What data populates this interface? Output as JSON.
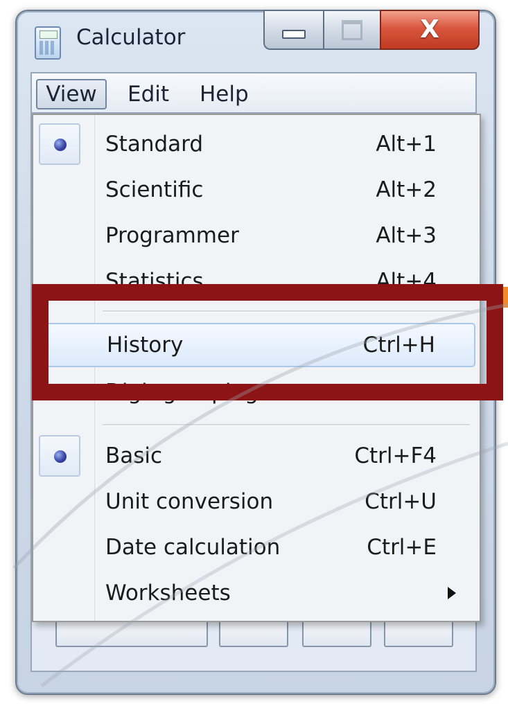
{
  "window": {
    "title": "Calculator",
    "icon": "calculator-icon",
    "controls": {
      "minimize_icon": "minimize-icon",
      "maximize_icon": "maximize-icon",
      "close_label": "X"
    }
  },
  "menubar": {
    "items": [
      {
        "label": "View",
        "active": true
      },
      {
        "label": "Edit"
      },
      {
        "label": "Help"
      }
    ]
  },
  "view_menu": {
    "items": [
      {
        "label": "Standard",
        "shortcut": "Alt+1",
        "selected": true
      },
      {
        "label": "Scientific",
        "shortcut": "Alt+2"
      },
      {
        "label": "Programmer",
        "shortcut": "Alt+3"
      },
      {
        "label": "Statistics",
        "shortcut": "Alt+4"
      },
      {
        "label": "History",
        "shortcut": "Ctrl+H",
        "highlighted": true
      },
      {
        "label": "Digit grouping",
        "shortcut": ""
      },
      {
        "label": "Basic",
        "shortcut": "Ctrl+F4",
        "selected": true
      },
      {
        "label": "Unit conversion",
        "shortcut": "Ctrl+U"
      },
      {
        "label": "Date calculation",
        "shortcut": "Ctrl+E"
      },
      {
        "label": "Worksheets",
        "submenu": true
      }
    ]
  },
  "colors": {
    "annotation": "#8c1414",
    "highlight_border": "#a9c8ea",
    "close_button": "#c13a22"
  }
}
